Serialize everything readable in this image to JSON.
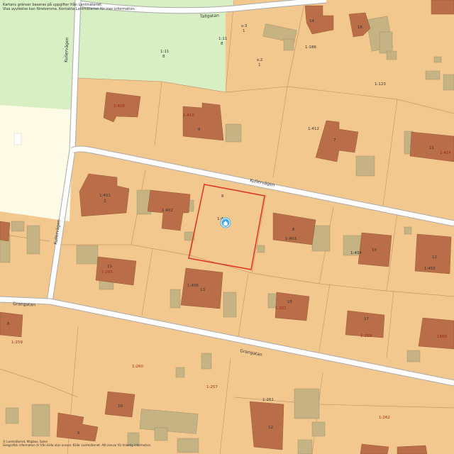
{
  "map": {
    "notice_line1": "Kartans gränser baseras på uppgifter från Lantmäteriet.",
    "notice_line2": "Visa avvikelse kan förekomma. Kontakta Lantmäteriet för mer information.",
    "copyright_line1": "© Lantmäteriet, Mapbox, Solen",
    "copyright_line2": "Geografisk information är från källa utan ansvar. Källa: Lantmäteriet. Allt ansvar för felaktig information.",
    "streets": {
      "tallgatan": "Tallgatan",
      "kullervagen_left": "Kullervägen",
      "kullervagen_lower": "Kullervägen",
      "kullervagen_main": "Kullervägen",
      "grangatan_left": "Grangatan",
      "grangatan_main": "Grangatan"
    },
    "parcel_labels": {
      "p_1_186": "1:186",
      "p_1_123": "1:123",
      "p_1_11a": "1:11",
      "p_8a": "8",
      "p_1_11b": "1:11",
      "p_8b": "8",
      "p_s3": "s:3",
      "p_s3n": "1",
      "p_s2": "s:2",
      "p_s2n": "1",
      "p_14": "14",
      "p_16": "16",
      "p_1_409": "1:409",
      "p_1_410": "1:410",
      "p_9": "9",
      "p_1_412": "1:412",
      "p_7": "7",
      "p_11a": "11",
      "p_1_414": "1:414",
      "p_1_401": "1:401",
      "p_2": "2",
      "p_1_402": "1:402",
      "p_6": "6",
      "p_1_403": "1:4",
      "p_8c": "8",
      "p_1_403b": "1:403",
      "p_1_404": "1:404",
      "p_10a": "10",
      "p_12a": "12",
      "p_1_455": "1:455",
      "p_11b": "11",
      "p_1_205": "1:205",
      "p_1_406": "1:406",
      "p_13": "13",
      "p_15": "15",
      "p_1_302": "1:302",
      "p_17": "17",
      "p_1_259b": "1:259",
      "p_1889": "1889",
      "p_8d": "8",
      "p_1_259": "1:259",
      "p_1_260": "1:260",
      "p_1_257": "1:257",
      "p_1_261": "1:261",
      "p_1_262": "1:262",
      "p_10b": "10",
      "p_12b": "12",
      "p_5": "5"
    },
    "colors": {
      "residential": "#f3c88f",
      "park": "#d8efc4",
      "open_land": "#fdfbe6",
      "building": "#b96e48",
      "outbuilding": "#c6b384",
      "road": "#ffffff",
      "road_edge": "#aaaaaa",
      "selected_parcel": "#e0331d",
      "pin": "#4aa8e6"
    },
    "pin_icon": "home-pin-icon"
  }
}
